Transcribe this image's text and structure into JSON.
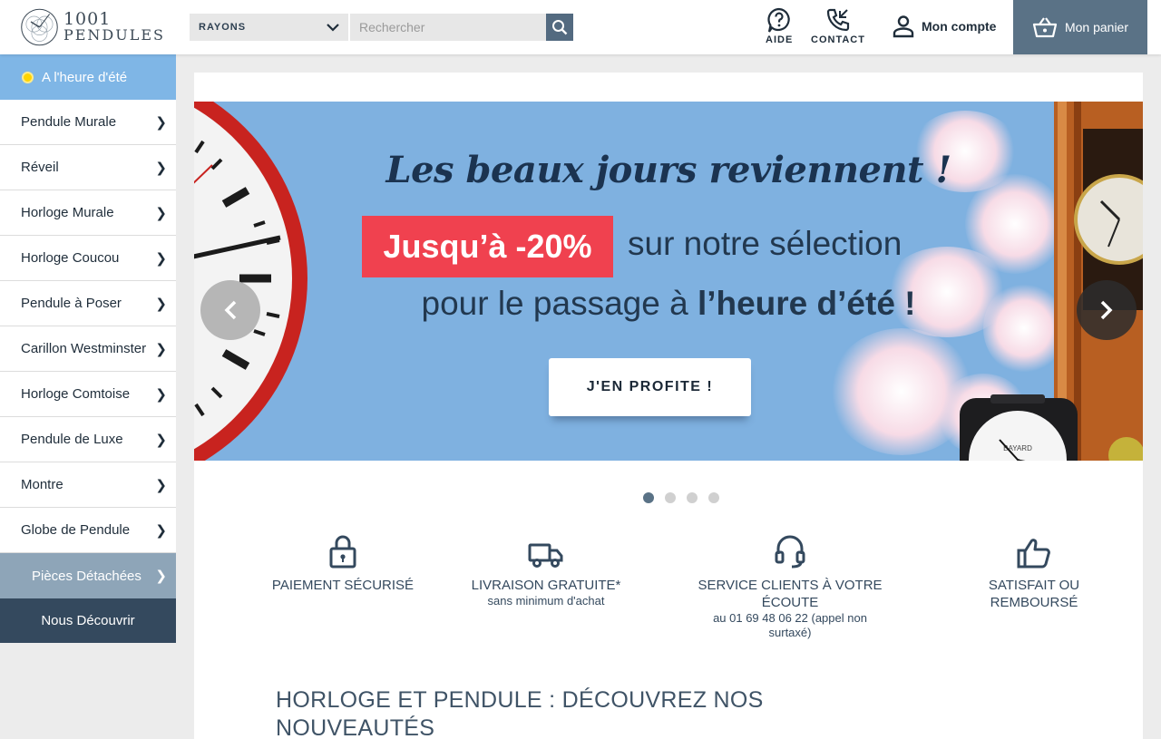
{
  "header": {
    "logo_number": "1001",
    "logo_word": "PENDULES",
    "rayons_label": "RAYONS",
    "search_placeholder": "Rechercher",
    "help_label": "AIDE",
    "contact_label": "CONTACT",
    "account_label": "Mon compte",
    "cart_label": "Mon panier",
    "icons": {
      "search": "search-icon",
      "help": "help-circle-icon",
      "contact": "phone-icon",
      "account": "user-icon",
      "cart": "basket-icon",
      "rayons": "chevron-down-icon"
    }
  },
  "sidebar": {
    "summer": "A l'heure d'été",
    "items": [
      "Pendule Murale",
      "Réveil",
      "Horloge Murale",
      "Horloge Coucou",
      "Pendule à Poser",
      "Carillon Westminster",
      "Horloge Comtoise",
      "Pendule de Luxe",
      "Montre",
      "Globe de Pendule"
    ],
    "pieces": "Pièces Détachées",
    "nous": "Nous Découvrir"
  },
  "banner": {
    "title": "Les beaux jours reviennent !",
    "promo": "Jusqu’à -20%",
    "promo_rest": "sur notre sélection",
    "line2_start": "pour le passage à ",
    "line2_bold": "l’heure d’été !",
    "cta": "J'EN PROFITE !",
    "alarm_brand": "BAYARD",
    "slides_count": 4,
    "active_slide": 1
  },
  "features": [
    {
      "title": "PAIEMENT SÉCURISÉ",
      "subtitle": "",
      "icon": "lock-icon"
    },
    {
      "title": "LIVRAISON GRATUITE*",
      "subtitle": "sans minimum d'achat",
      "icon": "truck-icon"
    },
    {
      "title": "SERVICE CLIENTS À VOTRE ÉCOUTE",
      "subtitle": "au 01 69 48 06 22 (appel non surtaxé)",
      "icon": "headset-icon"
    },
    {
      "title": "SATISFAIT OU REMBOURSÉ",
      "subtitle": "",
      "icon": "thumbs-up-icon"
    }
  ],
  "section_title": "HORLOGE ET PENDULE : DÉCOUVREZ NOS NOUVEAUTÉS",
  "colors": {
    "header_cart": "#5a7286",
    "sidebar_summer": "#7fb6e6",
    "sidebar_pieces": "#8ea5b8",
    "sidebar_nous": "#34495e",
    "banner_bg": "#7fb1e0",
    "promo_red": "#f0414f"
  }
}
